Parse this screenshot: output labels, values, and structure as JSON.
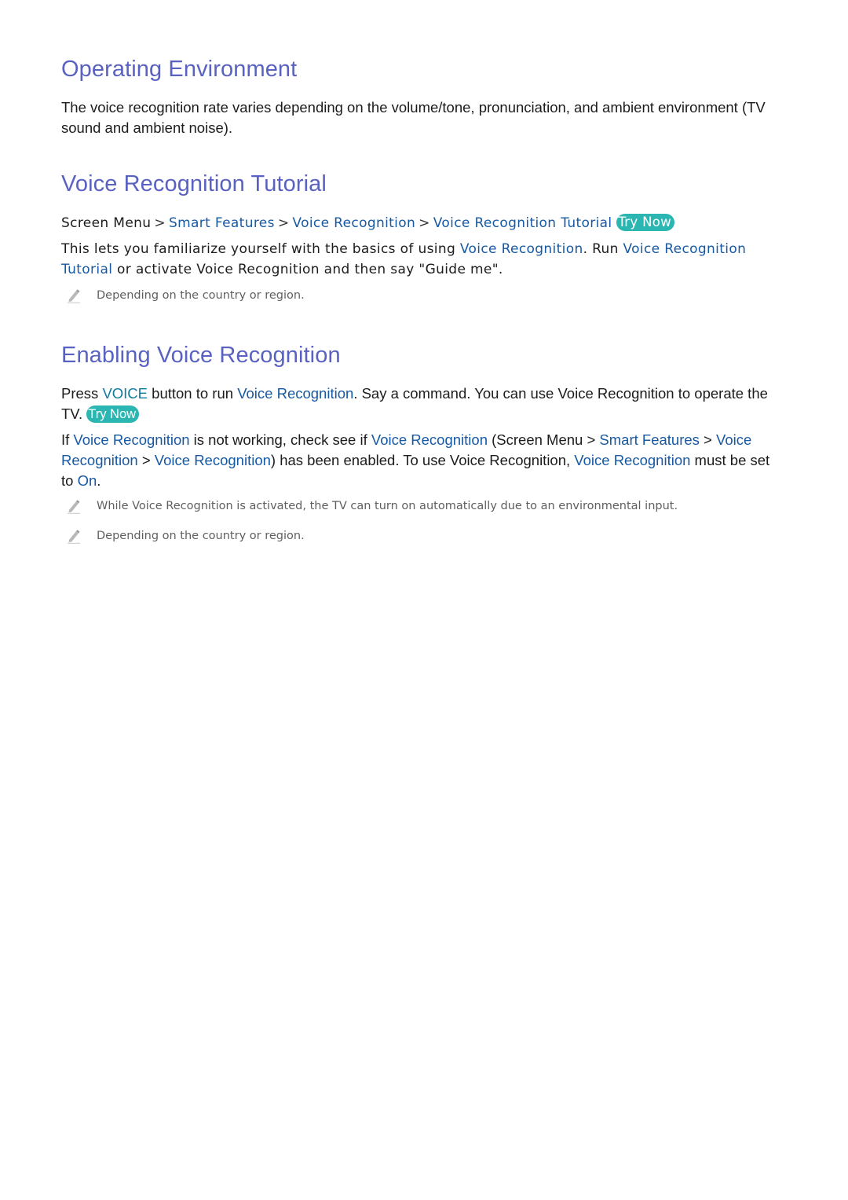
{
  "sections": [
    {
      "title": "Operating Environment",
      "body": "The voice recognition rate varies depending on the volume/tone, pronunciation, and ambient environment (TV sound and ambient noise)."
    },
    {
      "title": "Voice Recognition Tutorial",
      "breadcrumb": {
        "root": "Screen Menu",
        "separator": ">",
        "items": [
          "Smart Features",
          "Voice Recognition",
          "Voice Recognition Tutorial"
        ],
        "try_now": "Try Now"
      },
      "body": {
        "t1": "This lets you familiarize yourself with the basics of using ",
        "l1": "Voice Recognition",
        "t2": ". Run ",
        "l2": "Voice Recognition Tutorial",
        "t3": " or activate Voice Recognition and then say \"Guide me\"."
      },
      "notes": [
        "Depending on the country or region."
      ]
    },
    {
      "title": "Enabling Voice Recognition",
      "p1": {
        "t1": "Press ",
        "k1": "VOICE",
        "t2": " button to run ",
        "l1": "Voice Recognition",
        "t3": ". Say a command. You can use Voice Recognition to operate the TV. ",
        "try_now": "Try Now"
      },
      "p2": {
        "t1": "If ",
        "l1": "Voice Recognition",
        "t2": " is not working, check see if ",
        "l2": "Voice Recognition",
        "t3": " (Screen Menu > ",
        "l3": "Smart Features",
        "t4": " > ",
        "l4": "Voice Recognition",
        "t5": " > ",
        "l5": "Voice Recognition",
        "t6": ") has been enabled. To use Voice Recognition, ",
        "l6": "Voice Recognition",
        "t7": " must be set to ",
        "l7": "On",
        "t8": "."
      },
      "notes": [
        "While Voice Recognition is activated, the TV can turn on automatically due to an environmental input.",
        "Depending on the country or region."
      ]
    }
  ],
  "colors": {
    "heading": "#5a62c1",
    "link": "#1759a3",
    "key": "#0f7b9e",
    "try_now_bg": "#2cb6b2",
    "note_text": "#5f5f5f"
  }
}
